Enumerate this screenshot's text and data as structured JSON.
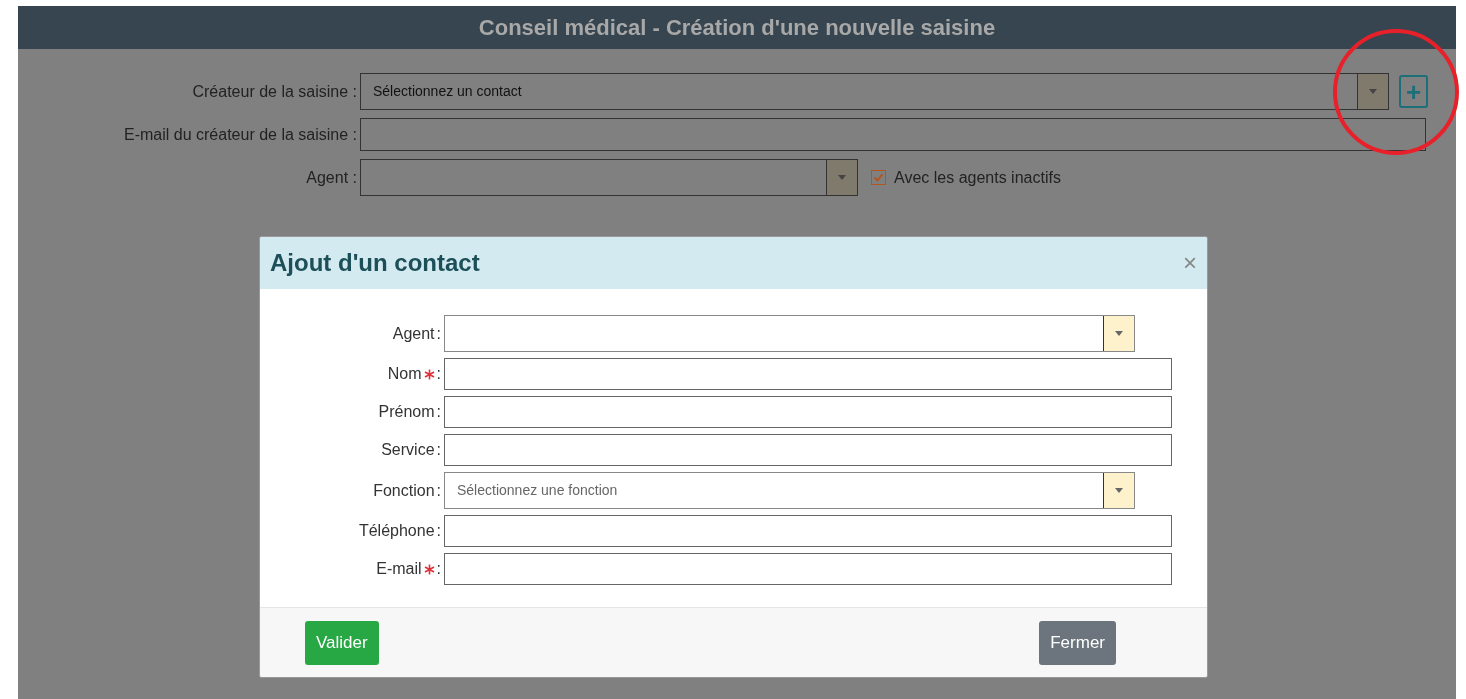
{
  "header": {
    "title": "Conseil médical - Création d'une nouvelle saisine"
  },
  "form": {
    "fields": [
      {
        "kind": "select",
        "label": "Créateur de la saisine :",
        "value": "Sélectionnez un contact",
        "add_button": "+"
      },
      {
        "kind": "text",
        "label": "E-mail du créateur de la saisine :"
      },
      {
        "kind": "select",
        "label": "Agent :",
        "checkbox": {
          "label": "Avec les agents inactifs",
          "checked": true
        }
      }
    ]
  },
  "annotation": {
    "kind": "circle"
  },
  "dialog": {
    "title": "Ajout d'un contact",
    "close": "×",
    "fields": [
      {
        "kind": "select",
        "label": "Agent",
        "required": false,
        "separator": ":"
      },
      {
        "kind": "text",
        "label": "Nom",
        "required": true,
        "separator": ":"
      },
      {
        "kind": "text",
        "label": "Prénom",
        "required": false,
        "separator": ":"
      },
      {
        "kind": "text",
        "label": "Service",
        "required": false,
        "separator": ":"
      },
      {
        "kind": "select",
        "label": "Fonction",
        "required": false,
        "separator": ":",
        "placeholder": "Sélectionnez une fonction"
      },
      {
        "kind": "text",
        "label": "Téléphone",
        "required": false,
        "separator": ":"
      },
      {
        "kind": "text",
        "label": "E-mail",
        "required": true,
        "separator": ":"
      }
    ],
    "buttons": [
      {
        "kind": "primary",
        "label": "Valider"
      },
      {
        "kind": "secondary",
        "label": "Fermer"
      }
    ]
  }
}
